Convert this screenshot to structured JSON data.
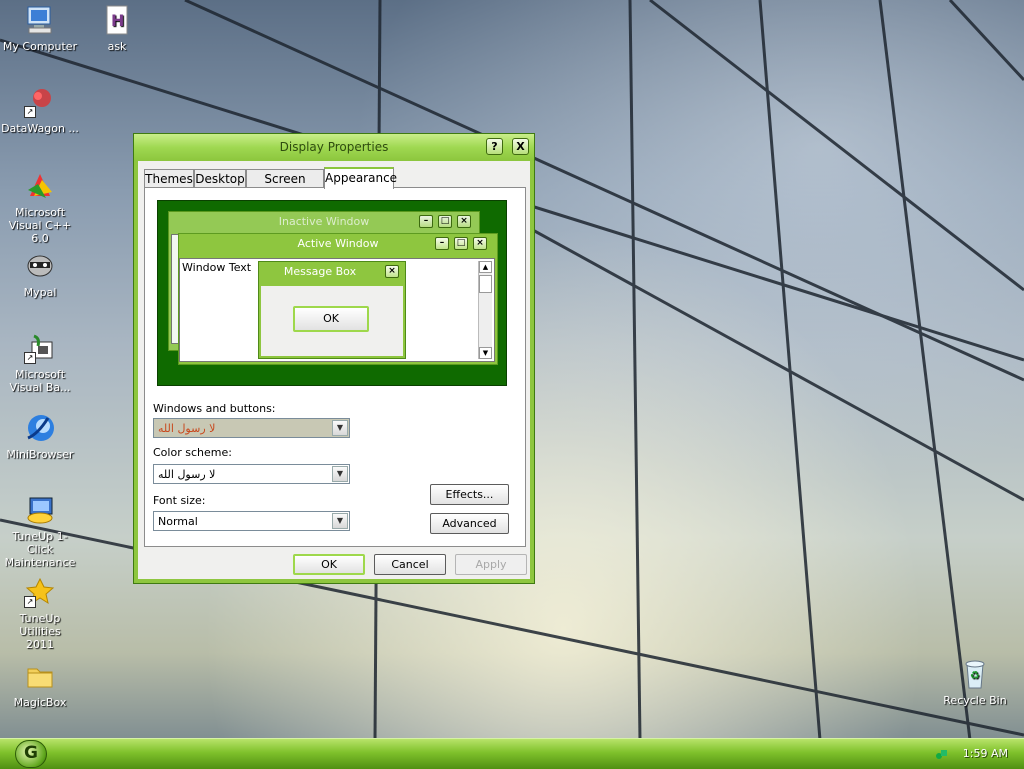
{
  "desktop": {
    "icons": [
      {
        "label": "My Computer",
        "icon": "computer-icon"
      },
      {
        "label": "ask",
        "icon": "document-h-icon"
      },
      {
        "label": "DataWagon ...",
        "icon": "datawagon-icon"
      },
      {
        "label": "Microsoft Visual C++ 6.0",
        "line1": "Microsoft",
        "line2": "Visual C++ 6.0",
        "icon": "visual-cpp-icon"
      },
      {
        "label": "Mypal",
        "icon": "mypal-raccoon-icon"
      },
      {
        "label": "Microsoft Visual Ba...",
        "line1": "Microsoft",
        "line2": "Visual Ba...",
        "icon": "visual-basic-icon"
      },
      {
        "label": "MiniBrowser",
        "icon": "minibrowser-icon"
      },
      {
        "label": "TuneUp 1-Click Maintenance",
        "line1": "TuneUp 1-Click",
        "line2": "Maintenance",
        "icon": "tuneup-maintenance-icon"
      },
      {
        "label": "TuneUp Utilities 2011",
        "line1": "TuneUp Utilities",
        "line2": "2011",
        "icon": "tuneup-utilities-icon"
      },
      {
        "label": "MagicBox",
        "icon": "folder-icon"
      },
      {
        "label": "Recycle Bin",
        "icon": "recycle-bin-icon"
      }
    ]
  },
  "dialog": {
    "title": "Display Properties",
    "help_button": "?",
    "close_button": "X",
    "tabs": [
      {
        "label": "Themes",
        "active": false
      },
      {
        "label": "Desktop",
        "active": false
      },
      {
        "label": "Screen Saver",
        "active": false
      },
      {
        "label": "Appearance",
        "active": true
      }
    ],
    "preview": {
      "inactive_title": "Inactive Window",
      "active_title": "Active Window",
      "window_text": "Window Text",
      "message_box_title": "Message Box",
      "ok_label": "OK"
    },
    "windows_and_buttons": {
      "label": "Windows and buttons:",
      "value": "لا رسول الله"
    },
    "color_scheme": {
      "label": "Color scheme:",
      "value": "لا رسول الله"
    },
    "font_size": {
      "label": "Font size:",
      "value": "Normal"
    },
    "effects_label": "Effects...",
    "advanced_label": "Advanced",
    "ok_label": "OK",
    "cancel_label": "Cancel",
    "apply_label": "Apply"
  },
  "taskbar": {
    "clock": "1:59 AM"
  },
  "colors": {
    "accent": "#8ec63f",
    "preview_background": "#0f6a00"
  }
}
